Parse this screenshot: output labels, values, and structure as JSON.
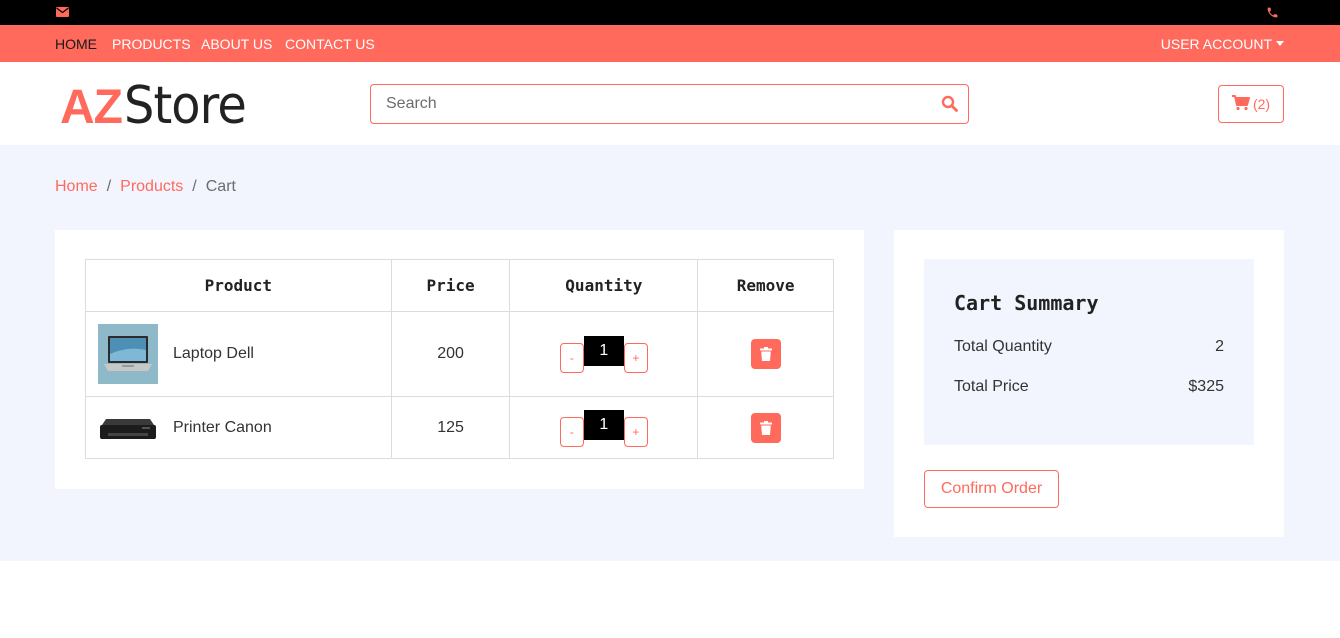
{
  "topbar": {
    "icons": [
      "envelope-icon",
      "phone-icon"
    ]
  },
  "nav": {
    "links": [
      "HOME",
      "PRODUCTS",
      "ABOUT US",
      "CONTACT US"
    ],
    "active": "HOME",
    "account_label": "USER ACCOUNT"
  },
  "header": {
    "logo_az": "AZ",
    "logo_store": "Store",
    "search_placeholder": "Search",
    "cart_count": "(2)"
  },
  "breadcrumb": {
    "home": "Home",
    "products": "Products",
    "current": "Cart",
    "separator": "/"
  },
  "cart_table": {
    "headers": [
      "Product",
      "Price",
      "Quantity",
      "Remove"
    ],
    "rows": [
      {
        "name": "Laptop Dell",
        "price": "200",
        "quantity": "1",
        "minus": "-",
        "plus": "+",
        "thumb": "laptop-icon"
      },
      {
        "name": "Printer Canon",
        "price": "125",
        "quantity": "1",
        "minus": "-",
        "plus": "+",
        "thumb": "printer-icon"
      }
    ]
  },
  "summary": {
    "title": "Cart Summary",
    "total_quantity_label": "Total Quantity",
    "total_quantity": "2",
    "total_price_label": "Total Price",
    "total_price": "$325",
    "confirm_label": "Confirm Order"
  },
  "colors": {
    "accent": "#ff6a5d",
    "topbar": "#000000",
    "background": "#f3f5fe"
  }
}
